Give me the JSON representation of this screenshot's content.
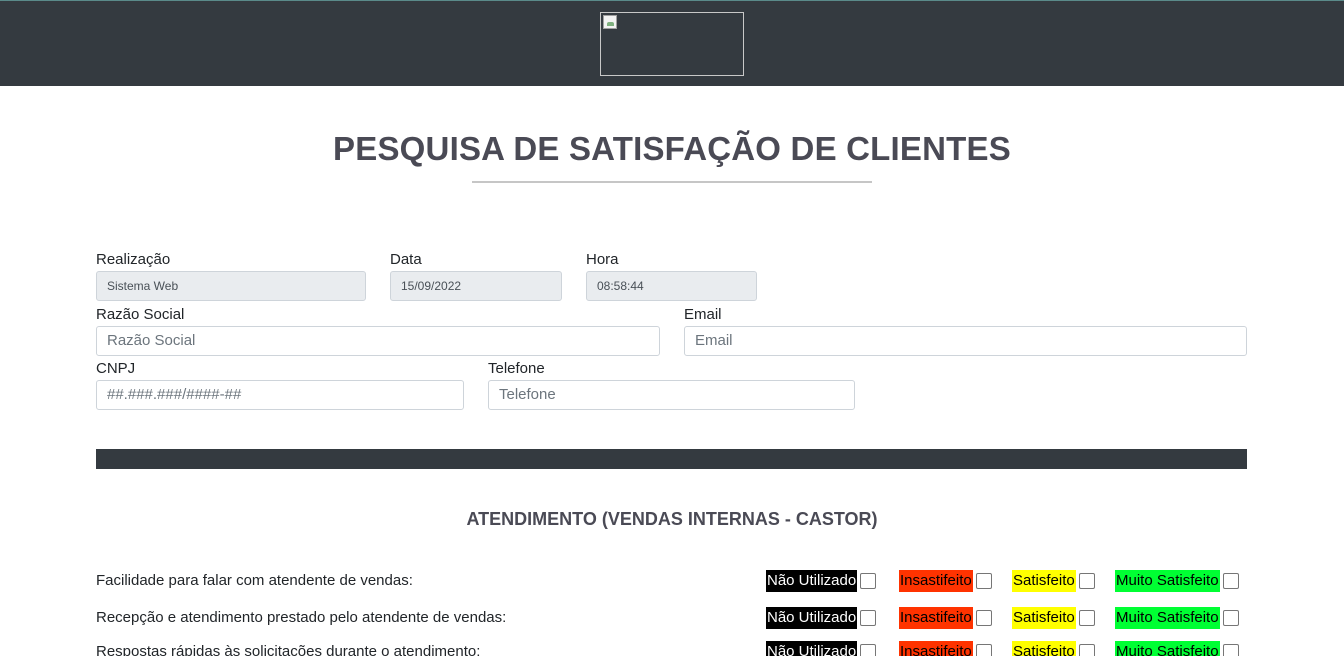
{
  "header": {
    "logo_icon": "broken-image-icon"
  },
  "page_title": "PESQUISA DE SATISFAÇÃO DE CLIENTES",
  "form": {
    "realizacao": {
      "label": "Realização",
      "value": "Sistema Web"
    },
    "data": {
      "label": "Data",
      "value": "15/09/2022"
    },
    "hora": {
      "label": "Hora",
      "value": "08:58:44"
    },
    "razao_social": {
      "label": "Razão Social",
      "placeholder": "Razão Social"
    },
    "email": {
      "label": "Email",
      "placeholder": "Email"
    },
    "cnpj": {
      "label": "CNPJ",
      "placeholder": "##.###.###/####-##"
    },
    "telefone": {
      "label": "Telefone",
      "placeholder": "Telefone"
    }
  },
  "section": {
    "title": "ATENDIMENTO (VENDAS INTERNAS - CASTOR)"
  },
  "options": [
    "Não Utilizado",
    "Insastifeito",
    "Satisfeito",
    "Muito Satisfeito"
  ],
  "option_colors": [
    "#000000",
    "#ff3300",
    "#ffff00",
    "#00ff33"
  ],
  "questions": [
    "Facilidade para falar com atendente de vendas:",
    "Recepção e atendimento prestado pelo atendente de vendas:",
    "Respostas rápidas às solicitações durante o atendimento:"
  ]
}
